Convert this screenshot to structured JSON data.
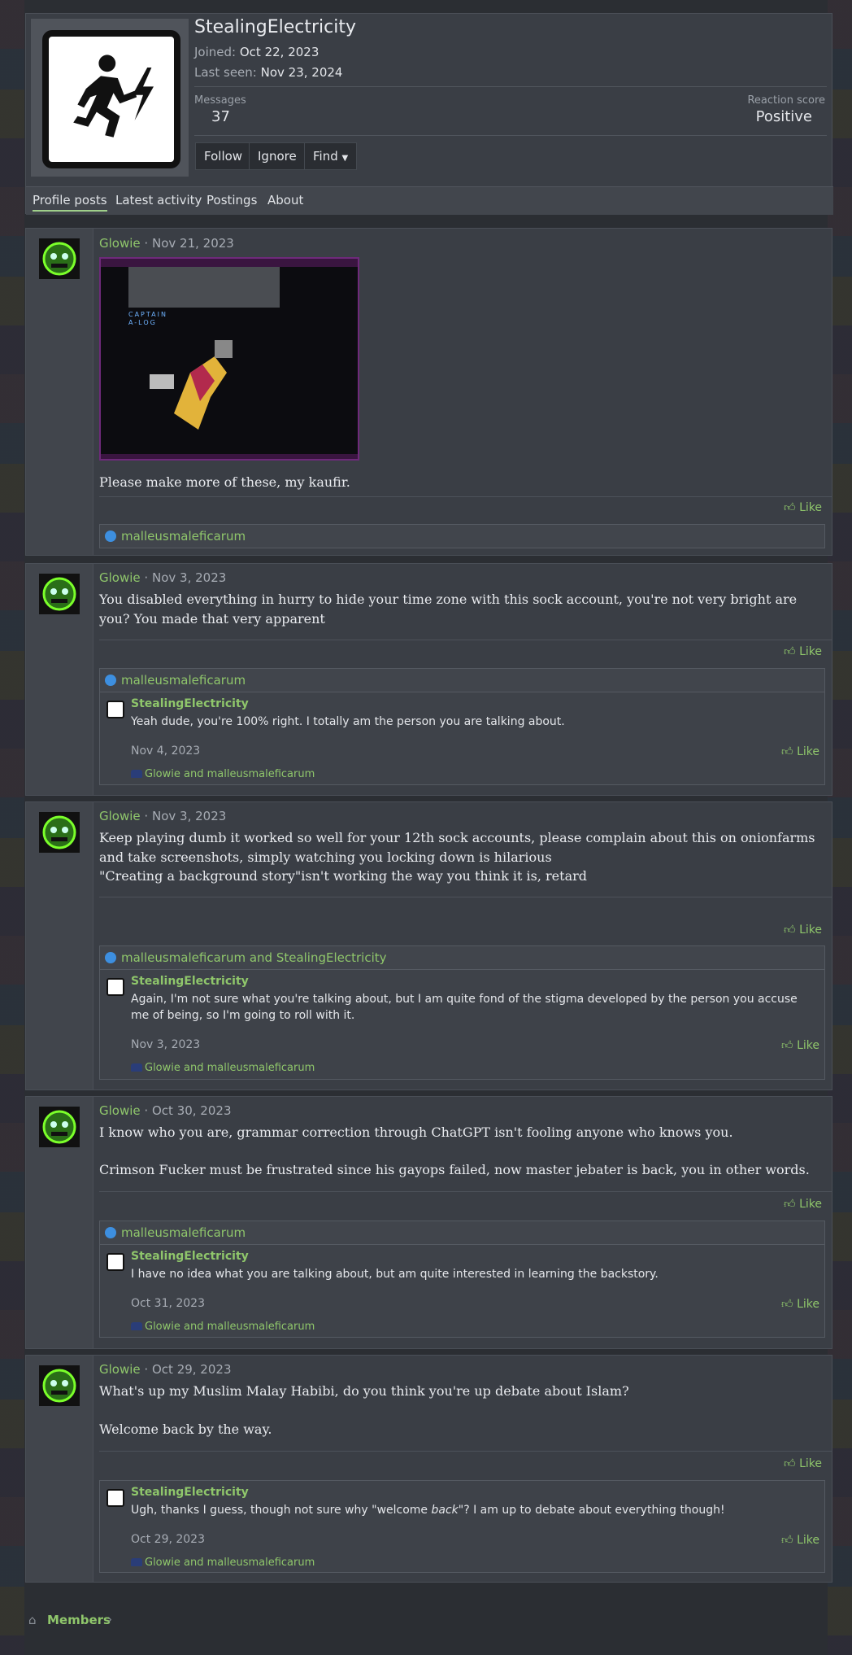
{
  "profile": {
    "username": "StealingElectricity",
    "joined_label": "Joined:",
    "joined_value": "Oct 22, 2023",
    "seen_label": "Last seen:",
    "seen_value": "Nov 23, 2024",
    "messages_label": "Messages",
    "messages_value": "37",
    "reaction_label": "Reaction score",
    "reaction_value": "Positive",
    "buttons": {
      "follow": "Follow",
      "ignore": "Ignore",
      "find": "Find"
    }
  },
  "tabs": [
    {
      "label": "Profile posts",
      "active": true
    },
    {
      "label": "Latest activity"
    },
    {
      "label": "Postings"
    },
    {
      "label": "About"
    }
  ],
  "posts": [
    {
      "author": "Glowie",
      "sep": "·",
      "date": "Nov 21, 2023",
      "text": "Please make more of these, my kaufir.",
      "like": "Like",
      "reactions": "malleusmaleficarum",
      "image": {
        "caption_a": "CAPTAIN",
        "caption_b": "A-LOG"
      }
    },
    {
      "author": "Glowie",
      "sep": "·",
      "date": "Nov 3, 2023",
      "text": "You disabled everything in hurry to hide your time zone with this sock account, you're not very bright are you? You made that very apparent",
      "like": "Like",
      "reactions": "malleusmaleficarum",
      "comment": {
        "author": "StealingElectricity",
        "text": "Yeah dude, you're 100% right. I totally am the person you are talking about.",
        "date": "Nov 4, 2023",
        "like": "Like",
        "reactions": "Glowie and malleusmaleficarum"
      }
    },
    {
      "author": "Glowie",
      "sep": "·",
      "date": "Nov 3, 2023",
      "text": "Keep playing dumb it worked so well for your 12th sock accounts, please complain about this on onionfarms and take screenshots, simply watching you locking down is hilarious",
      "text2": "\"Creating a background story\"isn't working the way you think it is, retard",
      "like": "Like",
      "reactions": "malleusmaleficarum and StealingElectricity",
      "comment": {
        "author": "StealingElectricity",
        "text": "Again, I'm not sure what you're talking about, but I am quite fond of the stigma developed by the person you accuse me of being, so I'm going to roll with it.",
        "date": "Nov 3, 2023",
        "like": "Like",
        "reactions": "Glowie and malleusmaleficarum"
      }
    },
    {
      "author": "Glowie",
      "sep": "·",
      "date": "Oct 30, 2023",
      "text": "I know who you are, grammar correction through ChatGPT isn't fooling anyone who knows you.",
      "text2": "Crimson Fucker must be frustrated since his gayops failed, now master jebater is back, you in other words.",
      "like": "Like",
      "reactions": "malleusmaleficarum",
      "comment": {
        "author": "StealingElectricity",
        "text": "I have no idea what you are talking about, but am quite interested in learning the backstory.",
        "date": "Oct 31, 2023",
        "like": "Like",
        "reactions": "Glowie and malleusmaleficarum"
      }
    },
    {
      "author": "Glowie",
      "sep": "·",
      "date": "Oct 29, 2023",
      "text": "What's up my Muslim Malay Habibi, do you think you're up debate about Islam?",
      "text2": "Welcome back by the way.",
      "like": "Like",
      "comment": {
        "author": "StealingElectricity",
        "text_a": "Ugh, thanks I guess, though not sure why \"welcome ",
        "text_em": "back",
        "text_b": "\"? I am up to debate about everything though!",
        "date": "Oct 29, 2023",
        "like": "Like",
        "reactions": "Glowie and malleusmaleficarum"
      }
    }
  ],
  "footer": {
    "breadcrumb": "Members",
    "chevron": "›"
  },
  "icons": {
    "like": "thumbs-up-outline",
    "reaction": "like-bubble",
    "home": "home-outline",
    "hat": "top-hat"
  },
  "colors": {
    "accent": "#8fc66b",
    "reaction_blue": "#3d8fe0",
    "background": "#2b2e33"
  }
}
